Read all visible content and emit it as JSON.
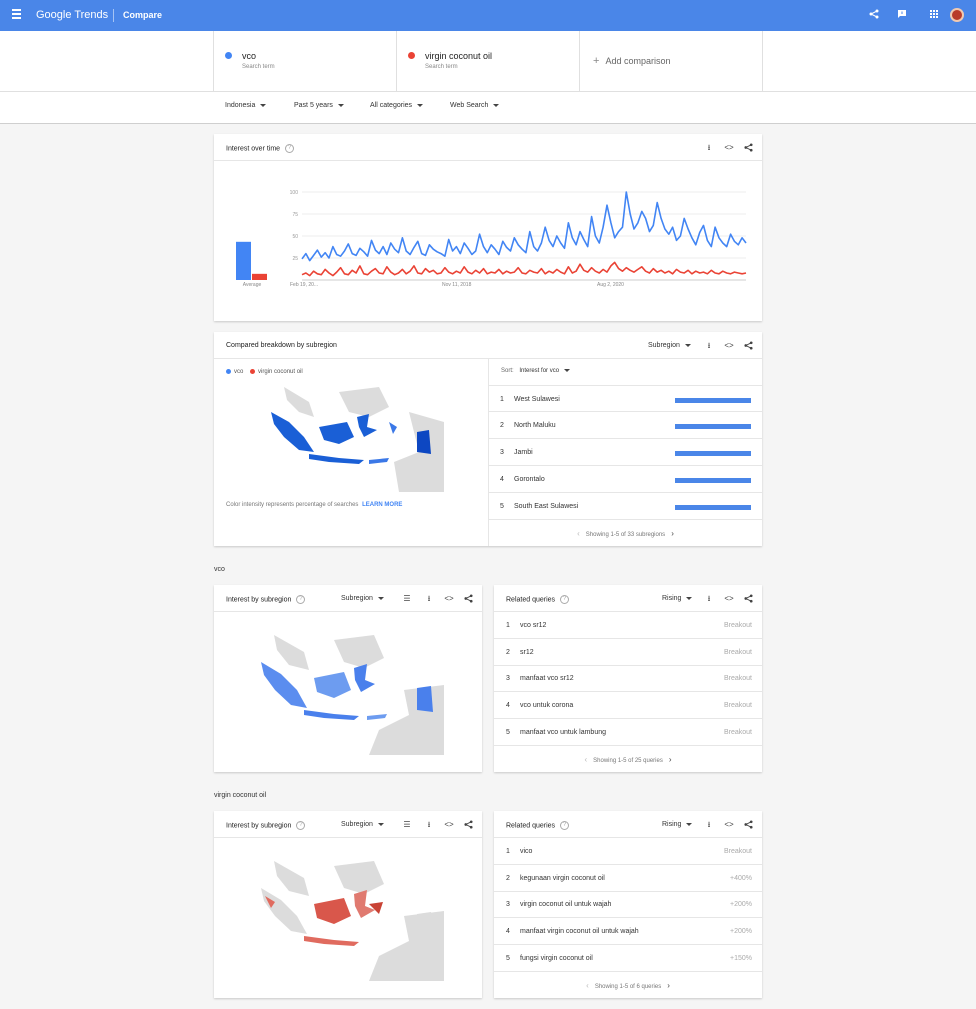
{
  "app": {
    "logo": "Google Trends",
    "page_title": "Compare"
  },
  "colors": {
    "vco": "#4285f4",
    "coconut": "#ea4335",
    "topbar": "#4a86e8"
  },
  "terms": [
    {
      "name": "vco",
      "sub": "Search term"
    },
    {
      "name": "virgin coconut oil",
      "sub": "Search term"
    }
  ],
  "add_comparison": "Add comparison",
  "filters": {
    "region": "Indonesia",
    "time": "Past 5 years",
    "category": "All categories",
    "property": "Web Search"
  },
  "iot": {
    "title": "Interest over time",
    "average_label": "Average",
    "y_ticks": [
      "100",
      "75",
      "50",
      "25"
    ],
    "x_ticks": [
      "Feb 19, 20...",
      "Nov 11, 2018",
      "Aug 2, 2020"
    ]
  },
  "breakdown": {
    "title": "Compared breakdown by subregion",
    "mode": "Subregion",
    "legend": [
      "vco",
      "virgin coconut oil"
    ],
    "sort_label": "Sort:",
    "sort_value": "Interest for vco",
    "note": "Color intensity represents percentage of searches",
    "learn_more": "LEARN MORE",
    "rows": [
      {
        "rank": "1",
        "name": "West Sulawesi",
        "vco_share": 1.0
      },
      {
        "rank": "2",
        "name": "North Maluku",
        "vco_share": 1.0
      },
      {
        "rank": "3",
        "name": "Jambi",
        "vco_share": 1.0
      },
      {
        "rank": "4",
        "name": "Gorontalo",
        "vco_share": 1.0
      },
      {
        "rank": "5",
        "name": "South East Sulawesi",
        "vco_share": 1.0
      }
    ],
    "pager": "Showing 1-5 of 33 subregions"
  },
  "sec_vco": {
    "label": "vco",
    "map_title": "Interest by subregion",
    "map_mode": "Subregion",
    "rq_title": "Related queries",
    "rq_mode": "Rising",
    "queries": [
      {
        "rank": "1",
        "q": "vco sr12",
        "v": "Breakout"
      },
      {
        "rank": "2",
        "q": "sr12",
        "v": "Breakout"
      },
      {
        "rank": "3",
        "q": "manfaat vco sr12",
        "v": "Breakout"
      },
      {
        "rank": "4",
        "q": "vco untuk corona",
        "v": "Breakout"
      },
      {
        "rank": "5",
        "q": "manfaat vco untuk lambung",
        "v": "Breakout"
      }
    ],
    "pager": "Showing 1-5 of 25 queries"
  },
  "sec_vcoil": {
    "label": "virgin coconut oil",
    "map_title": "Interest by subregion",
    "map_mode": "Subregion",
    "rq_title": "Related queries",
    "rq_mode": "Rising",
    "queries": [
      {
        "rank": "1",
        "q": "vico",
        "v": "Breakout"
      },
      {
        "rank": "2",
        "q": "kegunaan virgin coconut oil",
        "v": "+400%"
      },
      {
        "rank": "3",
        "q": "virgin coconut oil untuk wajah",
        "v": "+200%"
      },
      {
        "rank": "4",
        "q": "manfaat virgin coconut oil untuk wajah",
        "v": "+200%"
      },
      {
        "rank": "5",
        "q": "fungsi virgin coconut oil",
        "v": "+150%"
      }
    ],
    "pager": "Showing 1-5 of 6 queries"
  },
  "chart_data": {
    "type": "line",
    "ylim": [
      0,
      100
    ],
    "x_tick_labels": [
      "Feb 19, 20...",
      "Nov 11, 2018",
      "Aug 2, 2020"
    ],
    "averages": {
      "vco": 31,
      "virgin coconut oil": 5
    },
    "series": [
      {
        "name": "vco",
        "values": [
          24,
          30,
          22,
          28,
          34,
          26,
          31,
          25,
          38,
          29,
          27,
          33,
          41,
          30,
          28,
          36,
          32,
          27,
          45,
          34,
          30,
          38,
          29,
          42,
          35,
          31,
          48,
          33,
          29,
          37,
          44,
          30,
          28,
          40,
          35,
          32,
          30,
          27,
          46,
          33,
          38,
          30,
          42,
          36,
          29,
          33,
          52,
          38,
          31,
          40,
          35,
          29,
          44,
          37,
          33,
          48,
          40,
          35,
          31,
          55,
          38,
          33,
          42,
          60,
          45,
          38,
          50,
          42,
          36,
          65,
          48,
          40,
          55,
          46,
          38,
          72,
          50,
          42,
          60,
          85,
          65,
          48,
          55,
          60,
          100,
          75,
          58,
          65,
          78,
          70,
          55,
          62,
          88,
          70,
          58,
          52,
          60,
          45,
          50,
          70,
          58,
          48,
          40,
          54,
          62,
          45,
          38,
          60,
          48,
          42,
          38,
          52,
          44,
          40,
          48,
          42
        ]
      },
      {
        "name": "virgin coconut oil",
        "values": [
          6,
          8,
          5,
          10,
          7,
          6,
          12,
          8,
          5,
          9,
          14,
          7,
          6,
          11,
          8,
          16,
          7,
          6,
          10,
          13,
          8,
          7,
          15,
          9,
          6,
          8,
          12,
          7,
          10,
          16,
          8,
          7,
          13,
          9,
          11,
          7,
          8,
          14,
          9,
          7,
          10,
          8,
          15,
          9,
          7,
          11,
          8,
          13,
          7,
          9,
          8,
          12,
          7,
          10,
          8,
          9,
          14,
          8,
          7,
          11,
          9,
          8,
          13,
          7,
          10,
          8,
          12,
          9,
          7,
          15,
          8,
          10,
          18,
          11,
          9,
          14,
          10,
          8,
          12,
          9,
          16,
          20,
          13,
          10,
          14,
          11,
          9,
          12,
          15,
          10,
          8,
          13,
          9,
          11,
          8,
          10,
          7,
          12,
          9,
          8,
          11,
          7,
          10,
          8,
          9,
          7,
          11,
          8,
          7,
          10,
          8,
          7,
          9,
          8,
          7,
          8
        ]
      }
    ]
  }
}
